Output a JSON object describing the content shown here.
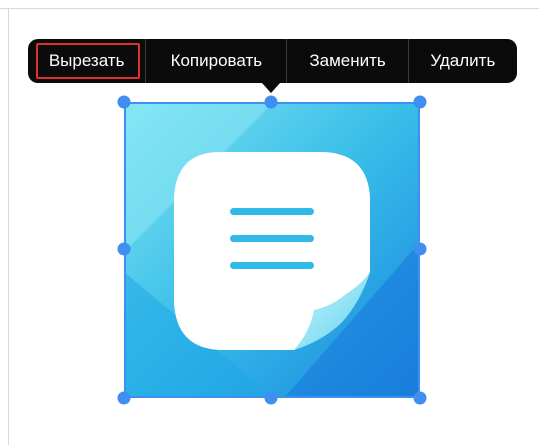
{
  "context_menu": {
    "items": [
      {
        "label": "Вырезать"
      },
      {
        "label": "Копировать"
      },
      {
        "label": "Заменить"
      },
      {
        "label": "Удалить"
      }
    ],
    "highlighted_item": "Вырезать"
  },
  "selected_image": {
    "icon": "notes-document-icon"
  },
  "colors": {
    "menu_background": "#0b0b0b",
    "menu_text": "#ffffff",
    "highlight_border": "#e0302b",
    "selection": "#3f8ef0"
  }
}
